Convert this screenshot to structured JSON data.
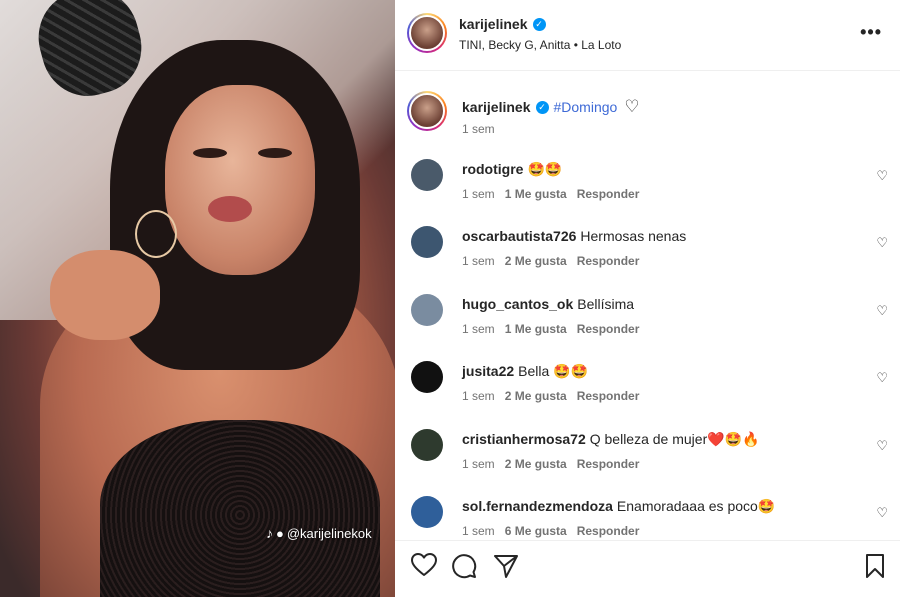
{
  "media": {
    "watermark_handle": "@karijelinekok",
    "watermark_icon": "tiktok-icon"
  },
  "header": {
    "username": "karijelinek",
    "audio": "TINI, Becky G, Anitta • La Loto",
    "more_label": "•••"
  },
  "caption": {
    "username": "karijelinek",
    "hashtag": "#Domingo",
    "time": "1 sem"
  },
  "comments": [
    {
      "username": "rodotigre",
      "text": "🤩🤩",
      "time": "1 sem",
      "likes": "1 Me gusta",
      "reply": "Responder",
      "avatar_color": "#4a5a6a"
    },
    {
      "username": "oscarbautista726",
      "text": "Hermosas nenas",
      "time": "1 sem",
      "likes": "2 Me gusta",
      "reply": "Responder",
      "avatar_color": "#3d5670"
    },
    {
      "username": "hugo_cantos_ok",
      "text": "Bellísima",
      "time": "1 sem",
      "likes": "1 Me gusta",
      "reply": "Responder",
      "avatar_color": "#7a8ca0"
    },
    {
      "username": "jusita22",
      "text": "Bella 🤩🤩",
      "time": "1 sem",
      "likes": "2 Me gusta",
      "reply": "Responder",
      "avatar_color": "#111111"
    },
    {
      "username": "cristianhermosa72",
      "text": "Q belleza de mujer❤️🤩🔥",
      "time": "1 sem",
      "likes": "2 Me gusta",
      "reply": "Responder",
      "avatar_color": "#2e3a2e"
    },
    {
      "username": "sol.fernandezmendoza",
      "text": "Enamoradaaa es poco🤩",
      "time": "1 sem",
      "likes": "6 Me gusta",
      "reply": "Responder",
      "avatar_color": "#2f5f9a"
    }
  ],
  "colors": {
    "link": "#3e6ad6",
    "verified": "#0095f6",
    "muted": "#737373"
  }
}
